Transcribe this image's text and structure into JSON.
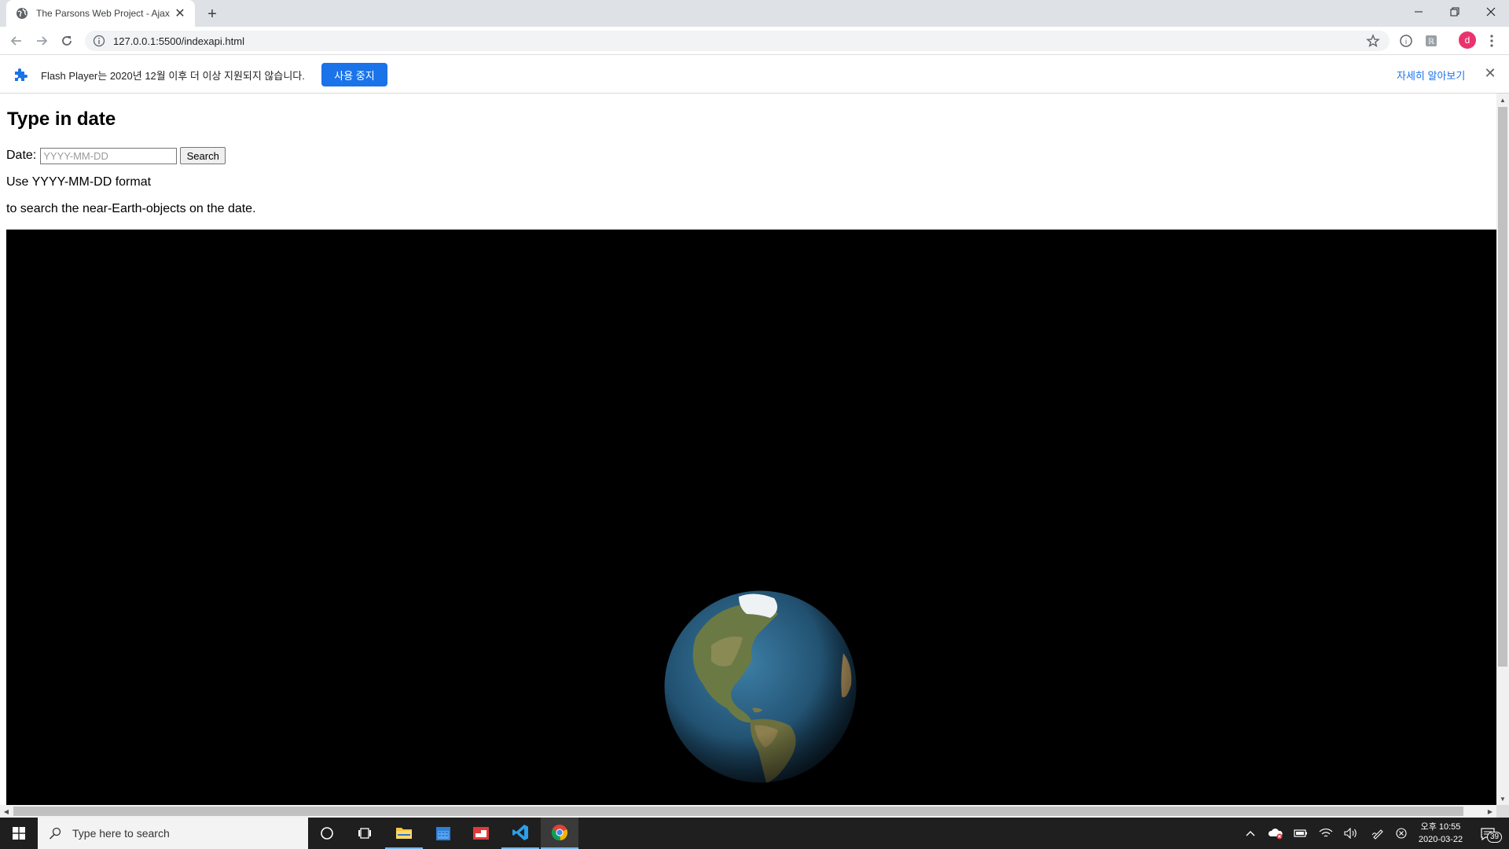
{
  "browser": {
    "tab_title": "The Parsons Web Project - Ajax",
    "url": "127.0.0.1:5500/indexapi.html",
    "profile_initial": "d"
  },
  "infobar": {
    "message": "Flash Player는 2020년 12월 이후 더 이상 지원되지 않습니다.",
    "stop_button": "사용 중지",
    "learn_more": "자세히 알아보기"
  },
  "page": {
    "heading": "Type in date",
    "date_label": "Date:",
    "date_placeholder": "YYYY-MM-DD",
    "date_value": "",
    "search_button": "Search",
    "help_line1": "Use YYYY-MM-DD format",
    "help_line2": "to search the near-Earth-objects on the date."
  },
  "taskbar": {
    "search_placeholder": "Type here to search",
    "clock_period": "오후 10:55",
    "clock_date": "2020-03-22",
    "notification_count": "39"
  },
  "colors": {
    "accent": "#1a73e8",
    "space": "#000000",
    "avatar": "#e8336e"
  }
}
